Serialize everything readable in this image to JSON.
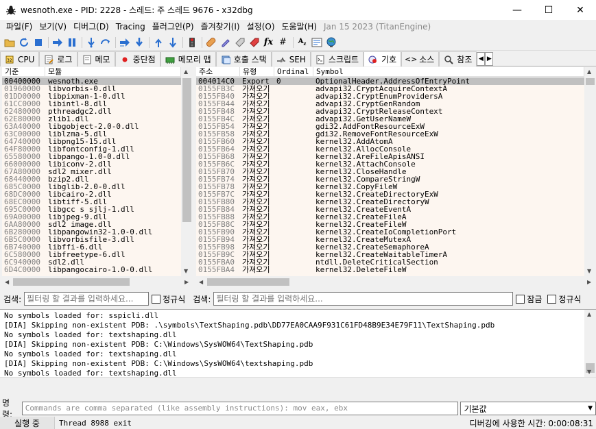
{
  "window": {
    "title": "wesnoth.exe - PID: 2228 - 스레드: 주 스레드 9676 - x32dbg",
    "minimize_glyph": "—",
    "maximize_glyph": "☐",
    "close_glyph": "✕"
  },
  "menu": [
    {
      "label": "파일(F)"
    },
    {
      "label": "보기(V)"
    },
    {
      "label": "디버그(D)"
    },
    {
      "label": "Tracing"
    },
    {
      "label": "플러그인(P)"
    },
    {
      "label": "즐겨찾기(I)"
    },
    {
      "label": "설정(O)"
    },
    {
      "label": "도움말(H)"
    }
  ],
  "build_info": "Jan 15 2023 (TitanEngine)",
  "tabs": [
    {
      "label": "CPU",
      "icon": "cpu-icon"
    },
    {
      "label": "로그",
      "icon": "log-icon"
    },
    {
      "label": "메모",
      "icon": "notes-icon"
    },
    {
      "label": "중단점",
      "icon": "breakpoint-icon"
    },
    {
      "label": "메모리 맵",
      "icon": "memory-map-icon"
    },
    {
      "label": "호출 스택",
      "icon": "call-stack-icon"
    },
    {
      "label": "SEH",
      "icon": "seh-icon"
    },
    {
      "label": "스크립트",
      "icon": "script-icon"
    },
    {
      "label": "기호",
      "icon": "symbols-icon",
      "active": true
    },
    {
      "label": "소스",
      "icon": "source-icon"
    },
    {
      "label": "참조",
      "icon": "references-icon"
    }
  ],
  "modules": {
    "headers": {
      "base": "기준",
      "module": "모듈"
    },
    "rows": [
      {
        "base": "00400000",
        "name": "wesnoth.exe",
        "selected": true
      },
      {
        "base": "01960000",
        "name": "libvorbis-0.dll"
      },
      {
        "base": "01DD0000",
        "name": "libpixman-1-0.dll"
      },
      {
        "base": "61CC0000",
        "name": "libintl-8.dll"
      },
      {
        "base": "62480000",
        "name": "pthreadgc2.dll"
      },
      {
        "base": "62E80000",
        "name": "zlib1.dll"
      },
      {
        "base": "63A40000",
        "name": "libgobject-2.0-0.dll"
      },
      {
        "base": "63C00000",
        "name": "liblzma-5.dll"
      },
      {
        "base": "64740000",
        "name": "libpng15-15.dll"
      },
      {
        "base": "64F80000",
        "name": "libfontconfig-1.dll"
      },
      {
        "base": "65580000",
        "name": "libpango-1.0-0.dll"
      },
      {
        "base": "66000000",
        "name": "libiconv-2.dll"
      },
      {
        "base": "67A80000",
        "name": "sdl2_mixer.dll"
      },
      {
        "base": "68440000",
        "name": "bzip2.dll"
      },
      {
        "base": "685C0000",
        "name": "libglib-2.0-0.dll"
      },
      {
        "base": "68DC0000",
        "name": "libcairo-2.dll"
      },
      {
        "base": "68EC0000",
        "name": "libtiff-5.dll"
      },
      {
        "base": "695C0000",
        "name": "libgcc_s_sjlj-1.dll"
      },
      {
        "base": "69A00000",
        "name": "libjpeg-9.dll"
      },
      {
        "base": "6AA80000",
        "name": "sdl2_image.dll"
      },
      {
        "base": "6B280000",
        "name": "libpangowin32-1.0-0.dll"
      },
      {
        "base": "6B5C0000",
        "name": "libvorbisfile-3.dll"
      },
      {
        "base": "6B740000",
        "name": "libffi-6.dll"
      },
      {
        "base": "6C580000",
        "name": "libfreetype-6.dll"
      },
      {
        "base": "6C940000",
        "name": "sdl2.dll"
      },
      {
        "base": "6D4C0000",
        "name": "libpangocairo-1.0-0.dll"
      }
    ]
  },
  "symbols": {
    "headers": {
      "address": "주소",
      "type": "유형",
      "ordinal": "Ordinal",
      "symbol": "Symbol"
    },
    "rows": [
      {
        "address": "004014C0",
        "type": "Export",
        "ordinal": "0",
        "symbol": "OptionalHeader.AddressOfEntryPoint",
        "selected": true
      },
      {
        "address": "0155FB3C",
        "type": "가져오기",
        "ordinal": "",
        "symbol": "advapi32.CryptAcquireContextA"
      },
      {
        "address": "0155FB40",
        "type": "가져오기",
        "ordinal": "",
        "symbol": "advapi32.CryptEnumProvidersA"
      },
      {
        "address": "0155FB44",
        "type": "가져오기",
        "ordinal": "",
        "symbol": "advapi32.CryptGenRandom"
      },
      {
        "address": "0155FB48",
        "type": "가져오기",
        "ordinal": "",
        "symbol": "advapi32.CryptReleaseContext"
      },
      {
        "address": "0155FB4C",
        "type": "가져오기",
        "ordinal": "",
        "symbol": "advapi32.GetUserNameW"
      },
      {
        "address": "0155FB54",
        "type": "가져오기",
        "ordinal": "",
        "symbol": "gdi32.AddFontResourceExW"
      },
      {
        "address": "0155FB58",
        "type": "가져오기",
        "ordinal": "",
        "symbol": "gdi32.RemoveFontResourceExW"
      },
      {
        "address": "0155FB60",
        "type": "가져오기",
        "ordinal": "",
        "symbol": "kernel32.AddAtomA"
      },
      {
        "address": "0155FB64",
        "type": "가져오기",
        "ordinal": "",
        "symbol": "kernel32.AllocConsole"
      },
      {
        "address": "0155FB68",
        "type": "가져오기",
        "ordinal": "",
        "symbol": "kernel32.AreFileApisANSI"
      },
      {
        "address": "0155FB6C",
        "type": "가져오기",
        "ordinal": "",
        "symbol": "kernel32.AttachConsole"
      },
      {
        "address": "0155FB70",
        "type": "가져오기",
        "ordinal": "",
        "symbol": "kernel32.CloseHandle"
      },
      {
        "address": "0155FB74",
        "type": "가져오기",
        "ordinal": "",
        "symbol": "kernel32.CompareStringW"
      },
      {
        "address": "0155FB78",
        "type": "가져오기",
        "ordinal": "",
        "symbol": "kernel32.CopyFileW"
      },
      {
        "address": "0155FB7C",
        "type": "가져오기",
        "ordinal": "",
        "symbol": "kernel32.CreateDirectoryExW"
      },
      {
        "address": "0155FB80",
        "type": "가져오기",
        "ordinal": "",
        "symbol": "kernel32.CreateDirectoryW"
      },
      {
        "address": "0155FB84",
        "type": "가져오기",
        "ordinal": "",
        "symbol": "kernel32.CreateEventA"
      },
      {
        "address": "0155FB88",
        "type": "가져오기",
        "ordinal": "",
        "symbol": "kernel32.CreateFileA"
      },
      {
        "address": "0155FB8C",
        "type": "가져오기",
        "ordinal": "",
        "symbol": "kernel32.CreateFileW"
      },
      {
        "address": "0155FB90",
        "type": "가져오기",
        "ordinal": "",
        "symbol": "kernel32.CreateIoCompletionPort"
      },
      {
        "address": "0155FB94",
        "type": "가져오기",
        "ordinal": "",
        "symbol": "kernel32.CreateMutexA"
      },
      {
        "address": "0155FB98",
        "type": "가져오기",
        "ordinal": "",
        "symbol": "kernel32.CreateSemaphoreA"
      },
      {
        "address": "0155FB9C",
        "type": "가져오기",
        "ordinal": "",
        "symbol": "kernel32.CreateWaitableTimerA"
      },
      {
        "address": "0155FBA0",
        "type": "가져오기",
        "ordinal": "",
        "symbol": "ntdll.DeleteCriticalSection"
      },
      {
        "address": "0155FBA4",
        "type": "가져오기",
        "ordinal": "",
        "symbol": "kernel32.DeleteFileW"
      }
    ]
  },
  "search_left": {
    "label": "검색:",
    "placeholder": "필터링 할 결과를 입력하세요...",
    "regex_label": "정규식"
  },
  "search_right": {
    "label": "검색:",
    "placeholder": "필터링 할 결과를 입력하세요...",
    "lock_label": "잠금",
    "regex_label": "정규식"
  },
  "log_lines": [
    "No symbols loaded for: sspicli.dll",
    "[DIA] Skipping non-existent PDB: .\\symbols\\TextShaping.pdb\\DD77EA0CAA9F931C61FD48B9E34E79F11\\TextShaping.pdb",
    "No symbols loaded for: textshaping.dll",
    "[DIA] Skipping non-existent PDB: C:\\Windows\\SysWOW64\\TextShaping.pdb",
    "No symbols loaded for: textshaping.dll",
    "[DIA] Skipping non-existent PDB: C:\\Windows\\SysWOW64\\textshaping.pdb",
    "No symbols loaded for: textshaping.dll"
  ],
  "command": {
    "label": "명령:",
    "placeholder": "Commands are comma separated (like assembly instructions): mov eax, ebx",
    "mode": "기본값"
  },
  "status": {
    "state": "실행 중",
    "message": "Thread 8988 exit",
    "timer": "디버깅에 사용한 시간: 0:00:08:31"
  },
  "colors": {
    "selected_row": "#c0c0c0",
    "pane_bg": "#fdf6f0",
    "address_text": "#808080",
    "state_bg": "#e5e5e5"
  }
}
